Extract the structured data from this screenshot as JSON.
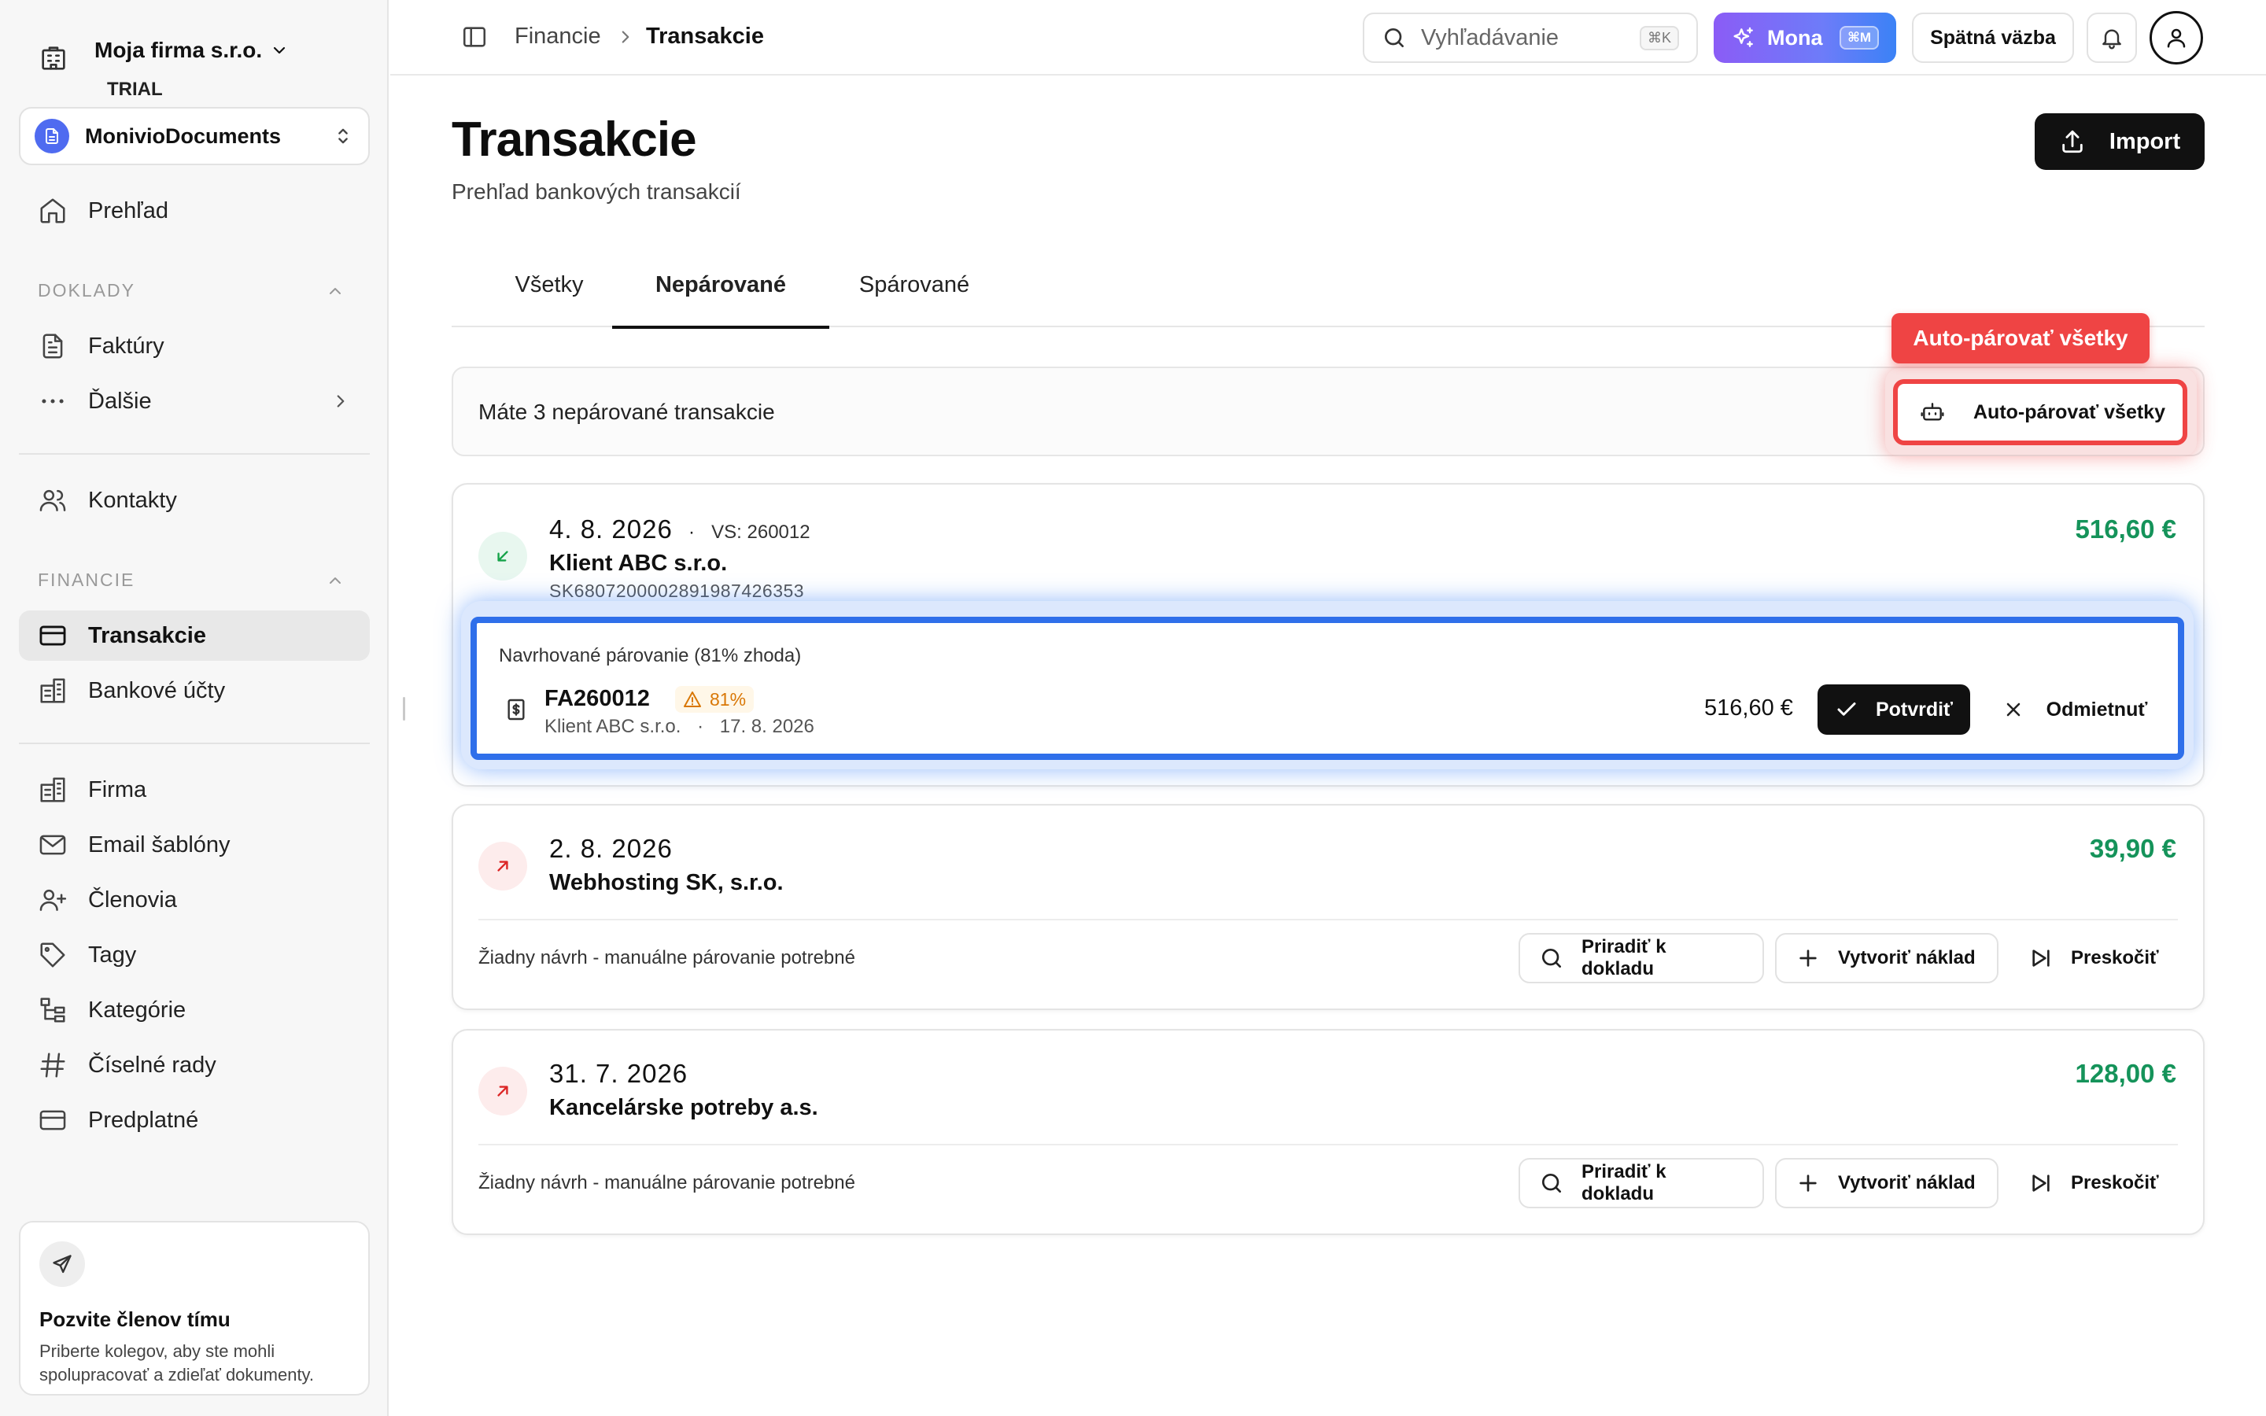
{
  "org": {
    "name": "Moja firma s.r.o.",
    "plan": "TRIAL"
  },
  "workspace": {
    "name": "MonivioDocuments"
  },
  "sidebar": {
    "overview": "Prehľad",
    "section_documents": "DOKLADY",
    "invoices": "Faktúry",
    "more": "Ďalšie",
    "contacts": "Kontakty",
    "section_finance": "FINANCIE",
    "transactions": "Transakcie",
    "bank_accounts": "Bankové účty",
    "company": "Firma",
    "email_templates": "Email šablóny",
    "members": "Členovia",
    "tags": "Tagy",
    "categories": "Kategórie",
    "number_series": "Číselné rady",
    "subscription": "Predplatné",
    "invite": {
      "title": "Pozvite členov tímu",
      "text": "Priberte kolegov, aby ste mohli spolupracovať a zdieľať dokumenty."
    }
  },
  "topbar": {
    "breadcrumb_parent": "Financie",
    "breadcrumb_current": "Transakcie",
    "search_placeholder": "Vyhľadávanie",
    "search_shortcut": "⌘K",
    "mona_label": "Mona",
    "mona_shortcut": "⌘M",
    "feedback_label": "Spätná väzba"
  },
  "page": {
    "title": "Transakcie",
    "subtitle": "Prehľad bankových transakcií",
    "import_label": "Import",
    "tabs": [
      "Všetky",
      "Nepárované",
      "Spárované"
    ],
    "active_tab": "Nepárované",
    "info_text": "Máte 3 nepárované transakcie",
    "auto_pair_tooltip": "Auto-párovať všetky",
    "auto_pair_label": "Auto-párovať všetky"
  },
  "transactions": [
    {
      "date": "4. 8. 2026",
      "vs": "VS: 260012",
      "party": "Klient ABC s.r.o.",
      "iban": "SK6807200002891987426353",
      "amount": "516,60 €",
      "direction": "incoming",
      "suggestion": {
        "title": "Navrhované párovanie (81% zhoda)",
        "doc_number": "FA260012",
        "match": "81%",
        "client": "Klient ABC s.r.o.",
        "sep": "·",
        "doc_date": "17. 8. 2026",
        "amount": "516,60 €",
        "confirm_label": "Potvrdiť",
        "reject_label": "Odmietnuť"
      }
    },
    {
      "date": "2. 8. 2026",
      "party": "Webhosting SK, s.r.o.",
      "amount": "39,90 €",
      "direction": "outgoing",
      "note": "Žiadny návrh - manuálne párovanie potrebné",
      "assign_label": "Priradiť k dokladu",
      "create_label": "Vytvoriť náklad",
      "skip_label": "Preskočiť"
    },
    {
      "date": "31. 7. 2026",
      "party": "Kancelárske potreby a.s.",
      "amount": "128,00 €",
      "direction": "outgoing",
      "note": "Žiadny návrh - manuálne párovanie potrebné",
      "assign_label": "Priradiť k dokladu",
      "create_label": "Vytvoriť náklad",
      "skip_label": "Preskočiť"
    }
  ],
  "colors": {
    "accent_blue": "#2f6fea",
    "highlight_red": "#ef4444",
    "amount_green": "#15935a",
    "mona_gradient_start": "#8b5cf6",
    "mona_gradient_end": "#3b82f6"
  }
}
